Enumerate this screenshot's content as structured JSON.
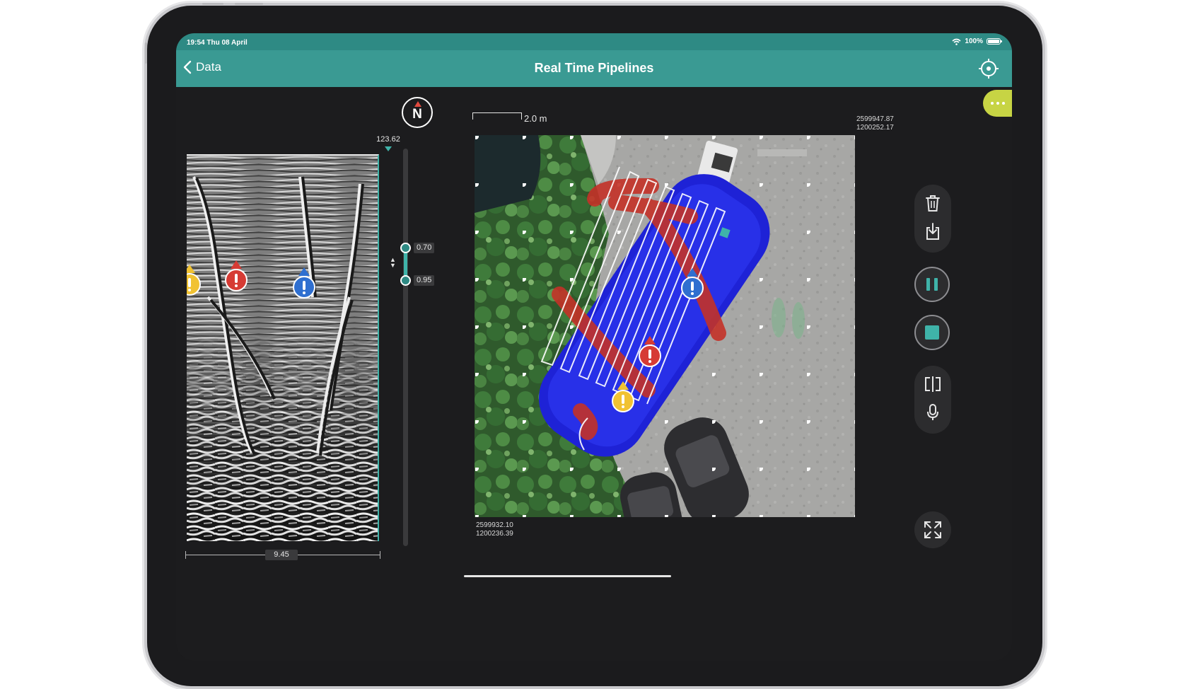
{
  "status_bar": {
    "time": "19:54 Thu 08 April",
    "battery": "100%",
    "battery_level": 1.0
  },
  "nav": {
    "back_label": "Data",
    "title": "Real Time Pipelines"
  },
  "compass": {
    "label": "N"
  },
  "radargram": {
    "depth_value": "123.62",
    "distance_value": "9.45"
  },
  "gain": {
    "upper_value": "0.70",
    "lower_value": "0.95"
  },
  "map": {
    "scale_label": "2.0 m",
    "top_right_coord": [
      "2599947.87",
      "1200252.17"
    ],
    "bottom_left_coord": [
      "2599932.10",
      "1200236.39"
    ]
  },
  "markers": [
    {
      "color": "#f1c232",
      "name": "yellow-marker"
    },
    {
      "color": "#d63b34",
      "name": "red-marker"
    },
    {
      "color": "#2f6fd0",
      "name": "blue-marker"
    }
  ],
  "colors": {
    "accent": "#3a9a93",
    "status": "#2e8a84",
    "more": "#c7d444"
  },
  "toolbar": {
    "icons": [
      "trash-icon",
      "download-icon",
      "pause-icon",
      "stop-icon",
      "split-view-icon",
      "microphone-icon",
      "expand-icon"
    ]
  }
}
